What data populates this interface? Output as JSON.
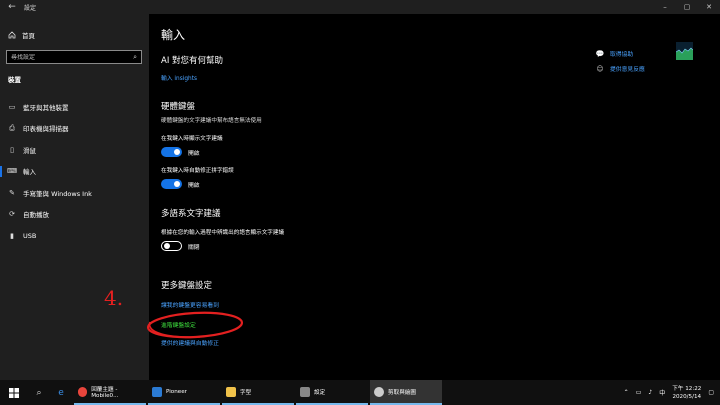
{
  "window": {
    "title": "設定"
  },
  "sidebar": {
    "home": "首頁",
    "search_placeholder": "尋找設定",
    "section": "裝置",
    "items": [
      {
        "label": "藍牙與其他裝置",
        "icon": "bluetooth-icon"
      },
      {
        "label": "印表機與掃描器",
        "icon": "printer-icon"
      },
      {
        "label": "滑鼠",
        "icon": "mouse-icon"
      },
      {
        "label": "輸入",
        "icon": "keyboard-icon"
      },
      {
        "label": "手寫筆與 Windows Ink",
        "icon": "pen-icon"
      },
      {
        "label": "自動播放",
        "icon": "autoplay-icon"
      },
      {
        "label": "USB",
        "icon": "usb-icon"
      }
    ]
  },
  "main": {
    "title": "輸入",
    "ai_heading": "AI 對您有何幫助",
    "insights_link": "輸入 insights",
    "hw_heading": "硬體鍵盤",
    "hw_desc": "硬體鍵盤的文字建議中幫布語言無法使用",
    "suggest_label": "在我鍵入時顯示文字建議",
    "suggest_state": "開啟",
    "autocorrect_label": "在我鍵入時自動修正拼字錯誤",
    "autocorrect_state": "開啟",
    "multi_heading": "多語系文字建議",
    "multi_label": "根據在您的輸入過程中辨識出的語言顯示文字建議",
    "multi_state": "關閉",
    "more_heading": "更多鍵盤設定",
    "more_links": [
      "讓我的鍵盤更容易看到",
      "進階鍵盤設定",
      "提供的建議與自動修正"
    ]
  },
  "help": {
    "get_help": "取得協助",
    "feedback": "提供意見反應"
  },
  "annotation": {
    "label": "4."
  },
  "taskbar": {
    "apps": [
      {
        "label": "回覆主題 - Mobile0...",
        "color": "#e8453c"
      },
      {
        "label": "Pioneer",
        "color": "#2b7bd4"
      },
      {
        "label": "字型",
        "color": "#f0c24a"
      },
      {
        "label": "設定",
        "color": "#888888"
      },
      {
        "label": "剪取與繪圖",
        "color": "#cccccc"
      }
    ],
    "time": "下午 12:22",
    "date": "2020/5/14"
  }
}
